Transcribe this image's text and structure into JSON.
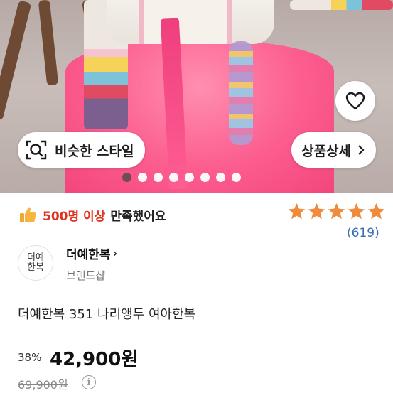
{
  "gallery": {
    "wish_icon": "heart-outline-icon",
    "similar_style_label": "비슷한 스타일",
    "similar_icon": "image-search-icon",
    "detail_label": "상품상세",
    "detail_icon": "chevron-right-icon",
    "slide_count": 8,
    "active_slide": 1
  },
  "satisfaction": {
    "icon": "thumbs-up-icon",
    "highlight": "500명 이상",
    "text": "만족했어요",
    "highlight_color": "#e0301e"
  },
  "rating": {
    "stars": 5,
    "review_count": "(619)",
    "star_color": "#f08a3c",
    "count_color": "#3a6fb5"
  },
  "brand": {
    "logo_text": "더예\n한복",
    "name": "더예한복",
    "chevron": "›",
    "shop_type": "브랜드샵"
  },
  "product": {
    "title": "더예한복 351 나리앵두 여아한복",
    "discount": "38%",
    "price": "42,900원",
    "original_price": "69,900원",
    "info_icon": "info-circle-icon"
  }
}
